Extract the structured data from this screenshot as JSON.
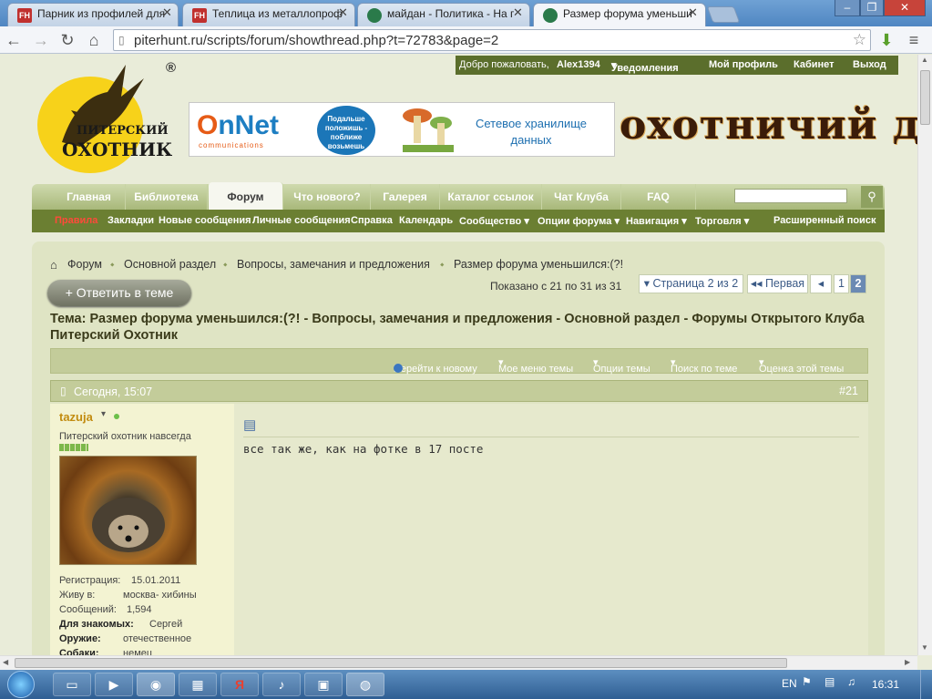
{
  "browser": {
    "tabs": [
      {
        "label": "Парник из профилей для",
        "favicon": "FH"
      },
      {
        "label": "Теплица из металлопроф",
        "favicon": "FH"
      },
      {
        "label": "майдан - Политика - На г",
        "favicon": ""
      },
      {
        "label": "Размер форума уменьши",
        "favicon": ""
      }
    ],
    "url": "piterhunt.ru/scripts/forum/showthread.php?t=72783&page=2"
  },
  "topstrip": {
    "welcome": "Добро пожаловать,",
    "user": "Alex1394",
    "notifications": "Уведомления",
    "profile": "Мой профиль",
    "cabinet": "Кабинет",
    "logout": "Выход"
  },
  "logo": {
    "line1": "ПИТЕРСКИЙ",
    "line2": "ОХОТНИК",
    "reg": "®"
  },
  "banner": {
    "brand": "OnNet",
    "brand_sub": "communications",
    "badge": "Подальше положишь - поближе возьмешь",
    "text": "Сетевое хранилище данных"
  },
  "hunt_logo": "охотничий д",
  "nav": [
    "Главная",
    "Библиотека",
    "Форум",
    "Что нового?",
    "Галерея",
    "Каталог ссылок",
    "Чат Клуба",
    "FAQ"
  ],
  "subnav": {
    "rules": "Правила",
    "items": [
      "Закладки",
      "Новые сообщения",
      "Личные сообщения",
      "Справка",
      "Календарь",
      "Сообщество ▾",
      "Опции форума ▾",
      "Навигация ▾",
      "Торговля ▾"
    ],
    "advanced": "Расширенный поиск"
  },
  "breadcrumb": [
    "Форум",
    "Основной раздел",
    "Вопросы, замечания и предложения",
    "Размер форума уменьшился:(?!"
  ],
  "reply_button": "+ Ответить в теме",
  "shown": "Показано с 21 по 31 из 31",
  "pagination": {
    "page_of": "▾ Страница 2 из 2",
    "first": "◂◂ Первая",
    "prev": "◂",
    "p1": "1",
    "p2": "2"
  },
  "thread_title": "Тема: Размер форума уменьшился:(?! - Вопросы, замечания и предложения - Основной раздел - Форумы Открытого Клуба Питерский Охотник",
  "thread_tools": {
    "goto_new": "Перейти к новому",
    "my_menu": "Мое меню темы",
    "options": "Опции темы",
    "search": "Поиск по теме",
    "rate": "Оценка этой темы"
  },
  "post": {
    "date": "Сегодня, 15:07",
    "number": "#21",
    "username": "tazuja",
    "user_title": "Питерский охотник навсегда",
    "info": [
      {
        "k": "Регистрация:",
        "v": "15.01.2011"
      },
      {
        "k": "Живу в:",
        "v": "москва- хибины"
      },
      {
        "k": "Сообщений:",
        "v": "1,594"
      },
      {
        "k": "Для знакомых:",
        "v": "Сергей"
      },
      {
        "k": "Оружие:",
        "v": "отечественное"
      },
      {
        "k": "Собаки:",
        "v": "немец"
      }
    ],
    "text": "все так же, как на фотке в 17 посте"
  },
  "taskbar": {
    "lang": "EN",
    "time": "16:31"
  }
}
